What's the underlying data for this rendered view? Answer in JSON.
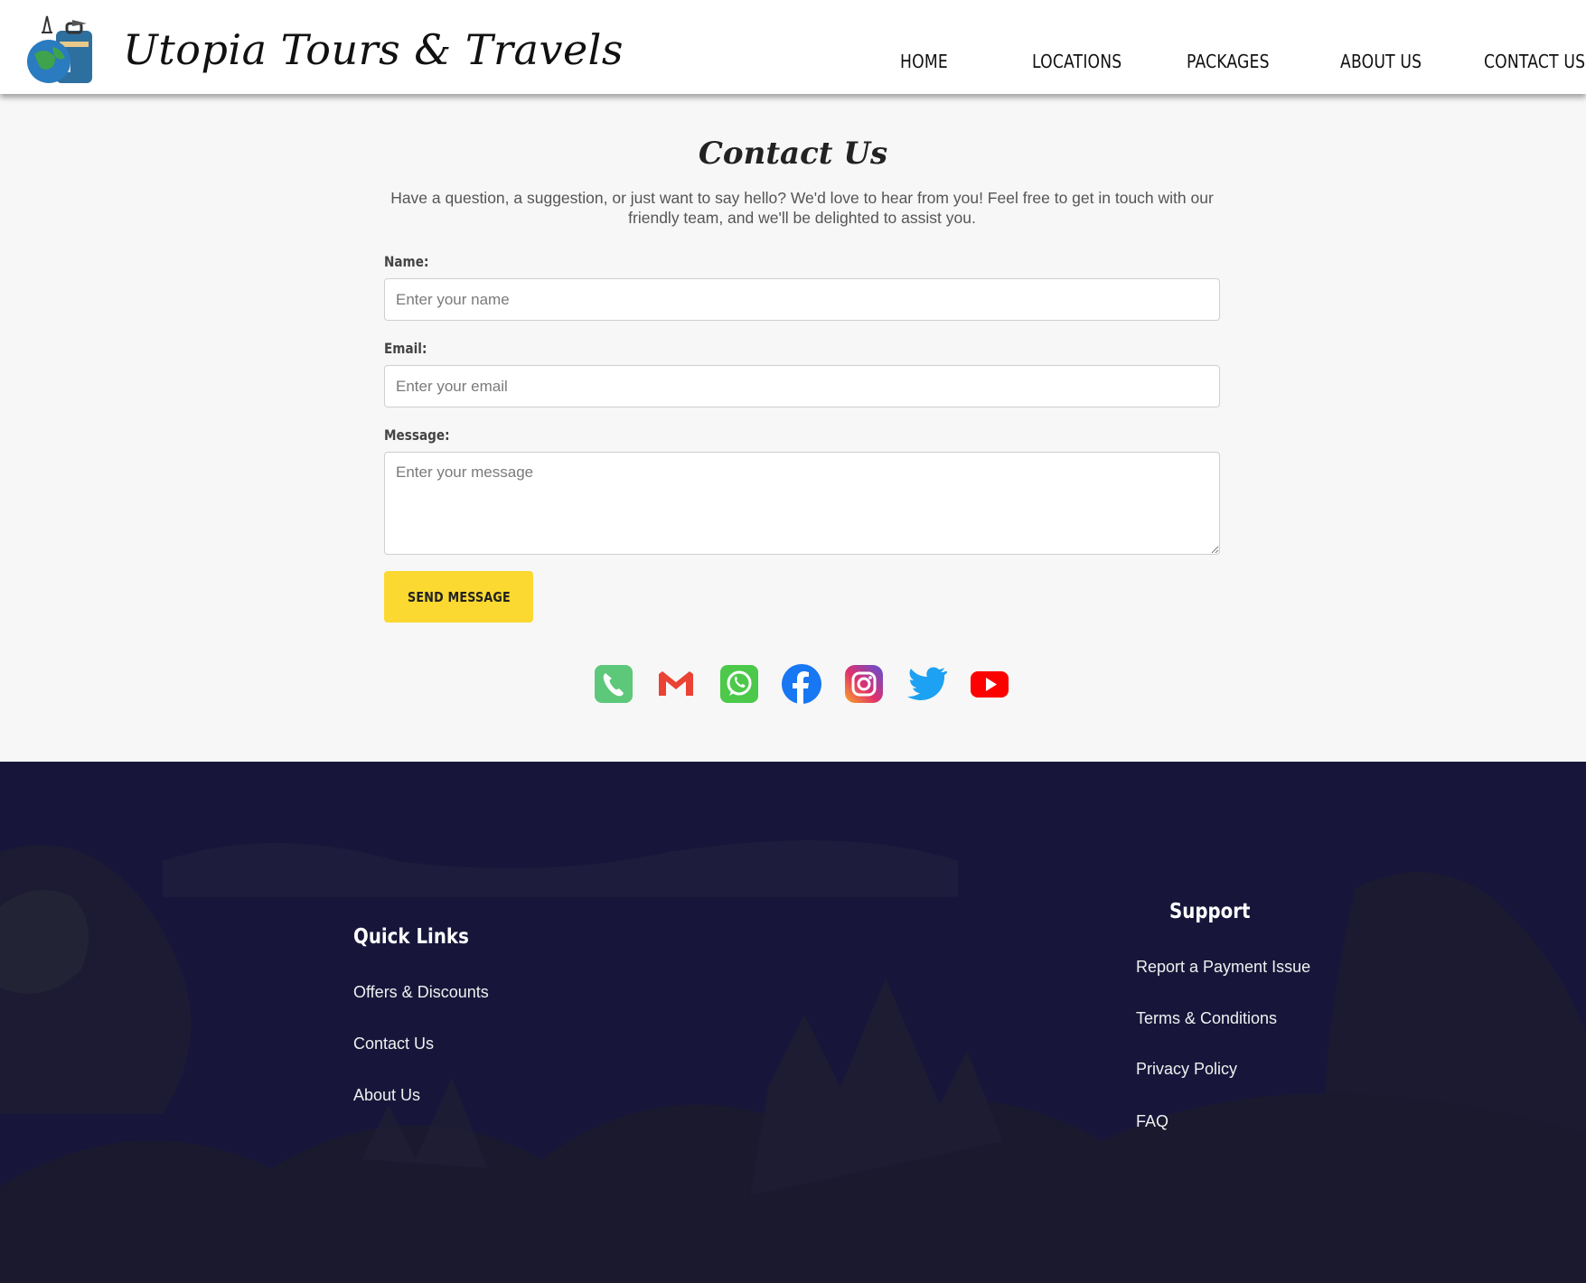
{
  "header": {
    "brand": "Utopia Tours & Travels",
    "nav": [
      "HOME",
      "LOCATIONS",
      "PACKAGES",
      "ABOUT US",
      "CONTACT US"
    ]
  },
  "contact": {
    "title": "Contact Us",
    "intro": "Have a question, a suggestion, or just want to say hello? We'd love to hear from you! Feel free to get in touch with our friendly team, and we'll be delighted to assist you.",
    "form": {
      "name_label": "Name:",
      "name_placeholder": "Enter your name",
      "email_label": "Email:",
      "email_placeholder": "Enter your email",
      "message_label": "Message:",
      "message_placeholder": "Enter your message",
      "submit_label": "SEND MESSAGE"
    },
    "social_icons": [
      "phone-icon",
      "gmail-icon",
      "whatsapp-icon",
      "facebook-icon",
      "instagram-icon",
      "twitter-icon",
      "youtube-icon"
    ]
  },
  "footer": {
    "quick_links": {
      "title": "Quick Links",
      "items": [
        "Offers & Discounts",
        "Contact Us",
        "About Us"
      ]
    },
    "support": {
      "title": "Support",
      "items": [
        "Report a Payment Issue",
        "Terms & Conditions",
        "Privacy Policy",
        "FAQ"
      ]
    }
  },
  "colors": {
    "accent_button": "#fbd930",
    "footer_background": "#17163a",
    "page_background": "#f7f7f7"
  }
}
